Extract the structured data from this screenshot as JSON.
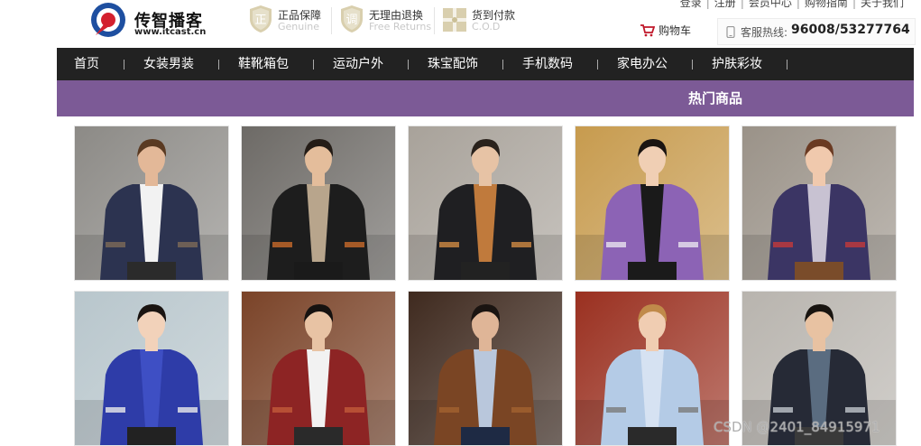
{
  "header": {
    "logo": {
      "cn": "传智播客",
      "en": "www.itcast.cn"
    },
    "promises": [
      {
        "badge": "正",
        "title": "正品保障",
        "subtitle": "Genuine"
      },
      {
        "badge": "调",
        "title": "无理由退换",
        "subtitle": "Free Returns"
      },
      {
        "badge": "",
        "title": "货到付款",
        "subtitle": "C.O.D"
      }
    ],
    "top_links": [
      "登录",
      "注册",
      "会员中心",
      "购物指南",
      "关于我们"
    ],
    "cart_label": "购物车",
    "hotline": {
      "label": "客服热线:",
      "number": "96008/53277764"
    }
  },
  "nav": {
    "items": [
      "首页",
      "女装男装",
      "鞋靴箱包",
      "运动户外",
      "珠宝配饰",
      "手机数码",
      "家电办公",
      "护肤彩妆"
    ]
  },
  "section": {
    "title": "热门商品"
  },
  "products": [
    {
      "bg": "#8c8a86",
      "skin": "#e3b898",
      "hair": "#5a3a22",
      "top": "#2c3350",
      "inner": "#f2f2f2",
      "bottom": "#2b2b2b",
      "accent": "#7e6a58"
    },
    {
      "bg": "#6d6a66",
      "skin": "#e4bd9b",
      "hair": "#241c16",
      "top": "#1d1d1d",
      "inner": "#b8a58c",
      "bottom": "#1a1a1a",
      "accent": "#c86a2a"
    },
    {
      "bg": "#a8a29a",
      "skin": "#e7c3a5",
      "hair": "#2a221c",
      "top": "#1f1f22",
      "inner": "#c07a3c",
      "bottom": "#222",
      "accent": "#d08a44"
    },
    {
      "bg": "#c79b4e",
      "skin": "#f0cfb4",
      "hair": "#1a1411",
      "top": "#8c63b5",
      "inner": "#1a1a1a",
      "bottom": "#1a1a1a",
      "accent": "#e8e3ef"
    },
    {
      "bg": "#9a9288",
      "skin": "#f0c9ad",
      "hair": "#6a3a22",
      "top": "#3b3564",
      "inner": "#c8c2d2",
      "bottom": "#7a4c2a",
      "accent": "#c43a3a"
    },
    {
      "bg": "#b8c6cc",
      "skin": "#f2d2ba",
      "hair": "#1a1411",
      "top": "#2e3ca8",
      "inner": "#3e4fc4",
      "bottom": "#222",
      "accent": "#eaeaea"
    },
    {
      "bg": "#7a4328",
      "skin": "#e8c3a4",
      "hair": "#161210",
      "top": "#8d2424",
      "inner": "#f2f2f2",
      "bottom": "#2a2a2a",
      "accent": "#c25a3a"
    },
    {
      "bg": "#3f2a1f",
      "skin": "#dfb597",
      "hair": "#1a1411",
      "top": "#7a4524",
      "inner": "#b9c7dc",
      "bottom": "#1e2a44",
      "accent": "#a3612f"
    },
    {
      "bg": "#9a3020",
      "skin": "#f0cdb2",
      "hair": "#c08a4a",
      "top": "#b4cbe6",
      "inner": "#d6e2f2",
      "bottom": "#2a2a2a",
      "accent": "#7a7a7a"
    },
    {
      "bg": "#b8b4ae",
      "skin": "#e8c2a2",
      "hair": "#181410",
      "top": "#262a36",
      "inner": "#5a6c80",
      "bottom": "#3a3a3a",
      "accent": "#c0c6cc"
    }
  ],
  "watermark": "CSDN @2401_84915971",
  "icons": [
    "logo-icon",
    "shield-badge-icon",
    "gift-icon",
    "cart-icon",
    "phone-icon"
  ],
  "colors": {
    "nav_bg": "#222222",
    "section_bg": "#7c5a96",
    "cart_red": "#c0182a"
  }
}
